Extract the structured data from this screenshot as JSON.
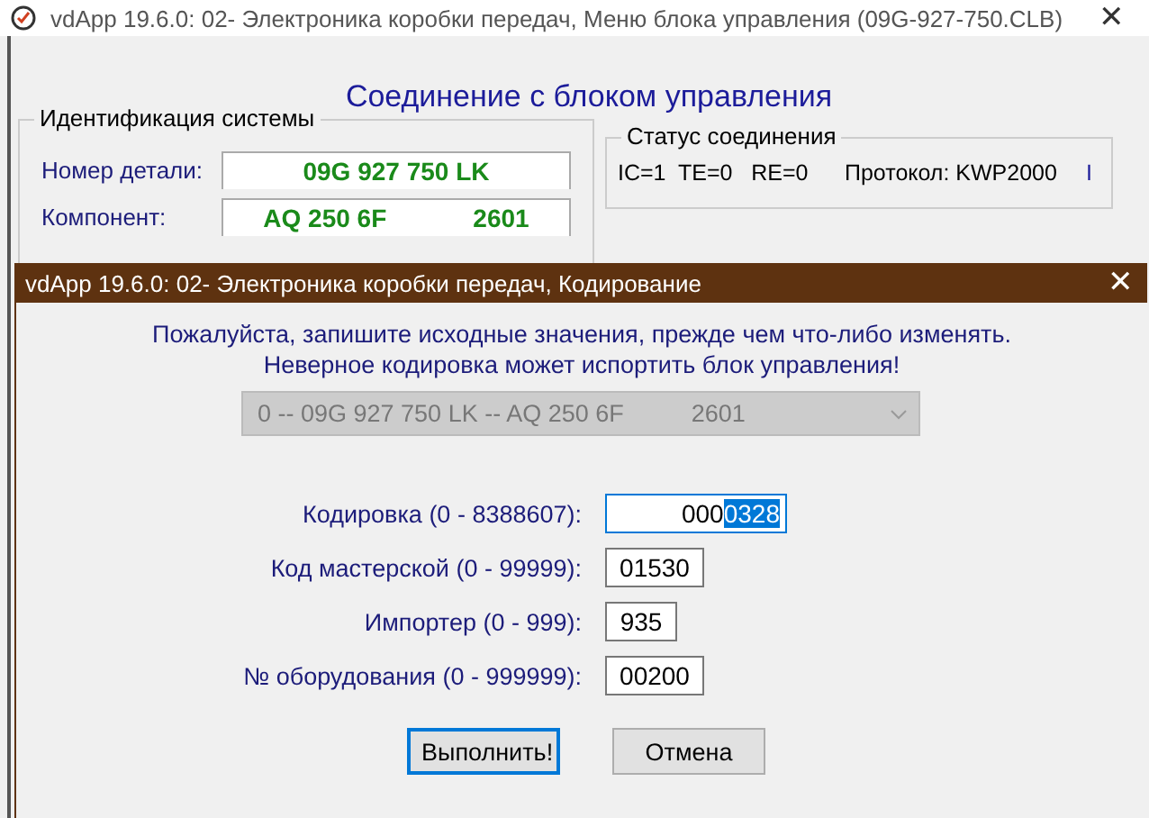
{
  "main_window": {
    "title": "vdApp 19.6.0: 02- Электроника коробки передач,  Меню блока управления (09G-927-750.CLB)",
    "close": "✕",
    "heading": "Соединение с блоком управления",
    "system_id": {
      "title": "Идентификация системы",
      "rows": [
        {
          "label": "Номер детали:",
          "values": [
            "09G 927 750 LK"
          ]
        },
        {
          "label": "Компонент:",
          "values": [
            "AQ 250 6F",
            "2601"
          ]
        }
      ]
    },
    "connection_status": {
      "title": "Статус соединения",
      "counters": "IC=1  TE=0   RE=0",
      "protocol": "Протокол: KWP2000",
      "indicator": "I"
    }
  },
  "dialog": {
    "title": "vdApp 19.6.0: 02- Электроника коробки передач,  Кодирование",
    "close": "✕",
    "warnings": [
      "Пожалуйста, запишите исходные значения, прежде чем что-либо изменять.",
      "Неверное кодировка может испортить блок управления!"
    ],
    "select": {
      "value": "0 -- 09G 927 750 LK -- AQ 250 6F          2601",
      "disabled": true
    },
    "fields": [
      {
        "label": "Кодировка (0 - 8388607):",
        "value": "000",
        "selected_value": "0328",
        "focused": true
      },
      {
        "label": "Код мастерской (0 - 99999):",
        "value": "01530",
        "focused": false
      },
      {
        "label": "Импортер (0 - 999):",
        "value": "935",
        "focused": false
      },
      {
        "label": "№ оборудования (0 - 999999):",
        "value": "00200",
        "focused": false
      }
    ],
    "buttons": [
      {
        "label": "Выполнить!",
        "default": true
      },
      {
        "label": "Отмена",
        "default": false
      }
    ]
  }
}
